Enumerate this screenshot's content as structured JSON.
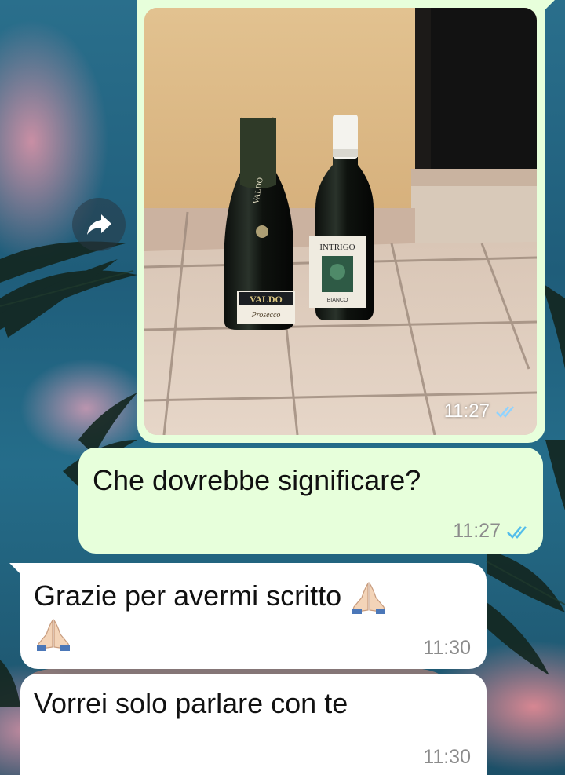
{
  "conversation": {
    "image_message": {
      "time": "11:27",
      "status": "read",
      "read_color": "#8fd3ff"
    },
    "messages": [
      {
        "direction": "outgoing",
        "text": "Che dovrebbe significare?",
        "time": "11:27",
        "status": "read",
        "tick_color": "#53bdeb"
      },
      {
        "direction": "incoming",
        "text": "Grazie per avermi scritto",
        "emoji": "folded-hands",
        "time": "11:30"
      },
      {
        "direction": "incoming",
        "text": "Vorrei solo parlare con te",
        "time": "11:30"
      }
    ]
  },
  "photo_labels": {
    "bottle_left": "VALDO",
    "bottle_left_sub": "Prosecco",
    "bottle_right": "INTRIGO",
    "bottle_right_sub": "BIANCO"
  },
  "colors": {
    "outgoing_bubble": "#e7ffdb",
    "incoming_bubble": "#ffffff",
    "time_text": "#8c8c8c"
  }
}
